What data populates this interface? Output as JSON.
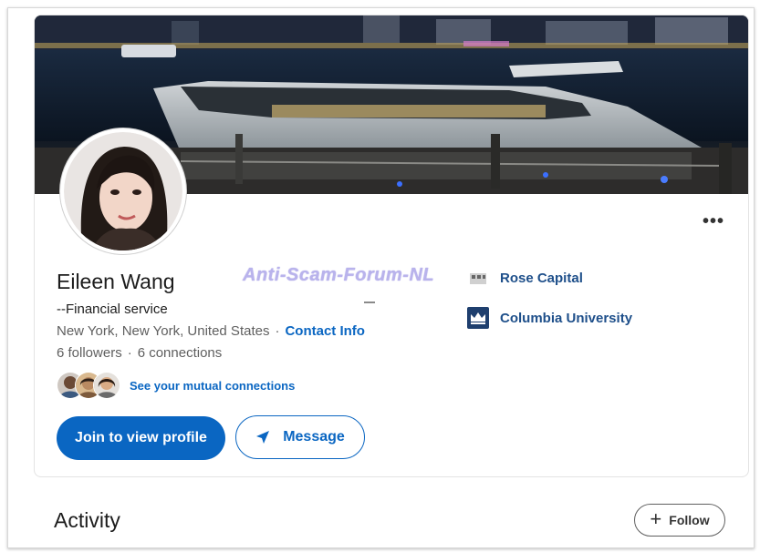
{
  "watermark": "Anti-Scam-Forum-NL",
  "profile": {
    "name": "Eileen Wang",
    "headline": "--Financial service",
    "location": "New York, New York, United States",
    "separator": "·",
    "contact_info": "Contact Info",
    "followers": "6 followers",
    "connections": "6 connections",
    "mutual_link": "See your mutual connections"
  },
  "buttons": {
    "join": "Join to view profile",
    "message": "Message",
    "more": "•••"
  },
  "companies": [
    {
      "label": "Rose Capital",
      "icon": "company-logo-icon"
    },
    {
      "label": "Columbia University",
      "icon": "university-crown-icon"
    }
  ],
  "activity": {
    "title": "Activity",
    "follow": "Follow"
  },
  "colors": {
    "accent": "#0a66c2",
    "company_text": "#1e4f8a",
    "muted_text": "#5f5f5f"
  }
}
